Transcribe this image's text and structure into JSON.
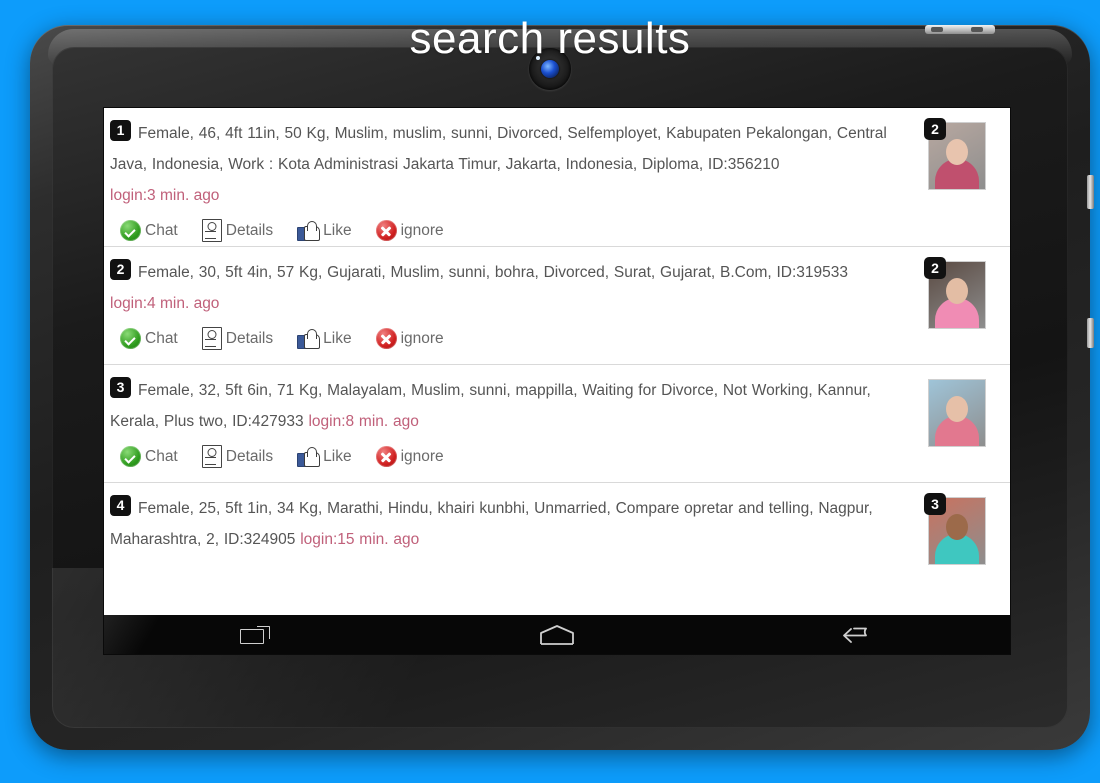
{
  "page": {
    "title": "search results",
    "background_color": "#0d9cfb"
  },
  "device": {
    "type": "android-tablet",
    "frame_color": "#222222",
    "camera": "front-camera-lens"
  },
  "navbar": {
    "recents_label": "recents",
    "home_label": "home",
    "back_label": "back"
  },
  "actions_labels": {
    "chat": "Chat",
    "details": "Details",
    "like": "Like",
    "ignore": "ignore"
  },
  "results": [
    {
      "index": "1",
      "description": "Female, 46, 4ft 11in, 50 Kg, Muslim, muslim, sunni, Divorced, Selfemployet, Kabupaten Pekalongan, Central Java, Indonesia, Work : Kota Administrasi Jakarta Timur, Jakarta, Indonesia, Diploma, ID:356210",
      "login": "login:3 min. ago",
      "login_inline": false,
      "photo_count": "2",
      "has_actions": true,
      "photo_colors": {
        "bg": "#b8a8a0",
        "skin": "#e8c4ae",
        "cloth": "#c0506e"
      }
    },
    {
      "index": "2",
      "description": "Female, 30, 5ft 4in, 57 Kg, Gujarati, Muslim, sunni, bohra, Divorced, Surat, Gujarat, B.Com, ID:319533",
      "login": "login:4 min. ago",
      "login_inline": false,
      "photo_count": "2",
      "has_actions": true,
      "photo_colors": {
        "bg": "#5a4a42",
        "skin": "#e3bda4",
        "cloth": "#f08cb4"
      }
    },
    {
      "index": "3",
      "description": "Female, 32, 5ft 6in, 71 Kg, Malayalam, Muslim, sunni, mappilla, Waiting for Divorce, Not Working, Kannur, Kerala, Plus two, ID:427933",
      "login": "login:8 min. ago",
      "login_inline": true,
      "photo_count": "",
      "has_actions": true,
      "photo_colors": {
        "bg": "#9fc4d8",
        "skin": "#e6c0a8",
        "cloth": "#e2788f"
      }
    },
    {
      "index": "4",
      "description": "Female, 25, 5ft 1in, 34 Kg, Marathi, Hindu, khairi kunbhi, Unmarried, Compare opretar and telling, Nagpur, Maharashtra, 2, ID:324905",
      "login": "login:15 min. ago",
      "login_inline": true,
      "photo_count": "3",
      "has_actions": false,
      "photo_colors": {
        "bg": "#c9725f",
        "skin": "#9c6a4a",
        "cloth": "#3fc7c0"
      }
    }
  ]
}
